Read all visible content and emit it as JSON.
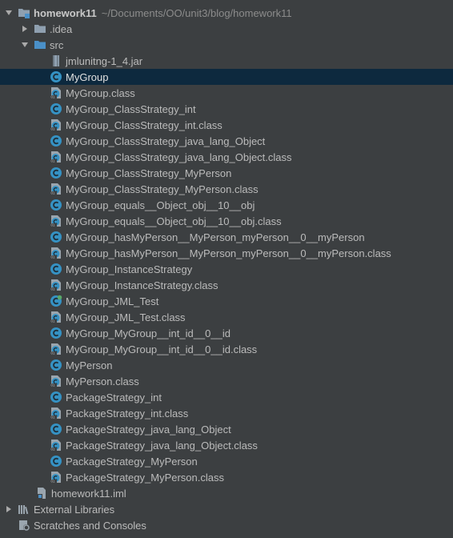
{
  "project": {
    "name": "homework11",
    "path": "~/Documents/OO/unit3/blog/homework11"
  },
  "folders": {
    "idea": ".idea",
    "src": "src"
  },
  "src_items": [
    {
      "label": "jmlunitng-1_4.jar",
      "icon": "jar-icon"
    },
    {
      "label": "MyGroup",
      "icon": "class-icon",
      "selected": true
    },
    {
      "label": "MyGroup.class",
      "icon": "class-file-icon"
    },
    {
      "label": "MyGroup_ClassStrategy_int",
      "icon": "class-icon"
    },
    {
      "label": "MyGroup_ClassStrategy_int.class",
      "icon": "class-file-icon"
    },
    {
      "label": "MyGroup_ClassStrategy_java_lang_Object",
      "icon": "class-icon"
    },
    {
      "label": "MyGroup_ClassStrategy_java_lang_Object.class",
      "icon": "class-file-icon"
    },
    {
      "label": "MyGroup_ClassStrategy_MyPerson",
      "icon": "class-icon"
    },
    {
      "label": "MyGroup_ClassStrategy_MyPerson.class",
      "icon": "class-file-icon"
    },
    {
      "label": "MyGroup_equals__Object_obj__10__obj",
      "icon": "class-icon"
    },
    {
      "label": "MyGroup_equals__Object_obj__10__obj.class",
      "icon": "class-file-icon"
    },
    {
      "label": "MyGroup_hasMyPerson__MyPerson_myPerson__0__myPerson",
      "icon": "class-icon"
    },
    {
      "label": "MyGroup_hasMyPerson__MyPerson_myPerson__0__myPerson.class",
      "icon": "class-file-icon"
    },
    {
      "label": "MyGroup_InstanceStrategy",
      "icon": "class-icon"
    },
    {
      "label": "MyGroup_InstanceStrategy.class",
      "icon": "class-file-icon"
    },
    {
      "label": "MyGroup_JML_Test",
      "icon": "test-class-icon"
    },
    {
      "label": "MyGroup_JML_Test.class",
      "icon": "class-file-icon"
    },
    {
      "label": "MyGroup_MyGroup__int_id__0__id",
      "icon": "class-icon"
    },
    {
      "label": "MyGroup_MyGroup__int_id__0__id.class",
      "icon": "class-file-icon"
    },
    {
      "label": "MyPerson",
      "icon": "class-icon"
    },
    {
      "label": "MyPerson.class",
      "icon": "class-file-icon"
    },
    {
      "label": "PackageStrategy_int",
      "icon": "class-icon"
    },
    {
      "label": "PackageStrategy_int.class",
      "icon": "class-file-icon"
    },
    {
      "label": "PackageStrategy_java_lang_Object",
      "icon": "class-icon"
    },
    {
      "label": "PackageStrategy_java_lang_Object.class",
      "icon": "class-file-icon"
    },
    {
      "label": "PackageStrategy_MyPerson",
      "icon": "class-icon"
    },
    {
      "label": "PackageStrategy_MyPerson.class",
      "icon": "class-file-icon"
    }
  ],
  "iml_file": "homework11.iml",
  "external_libraries": "External Libraries",
  "scratches": "Scratches and Consoles",
  "colors": {
    "background": "#3c3f41",
    "selection": "#0d293e",
    "folder": "#4a90c8",
    "class_icon": "#3592c4",
    "text": "#bbbbbb"
  }
}
